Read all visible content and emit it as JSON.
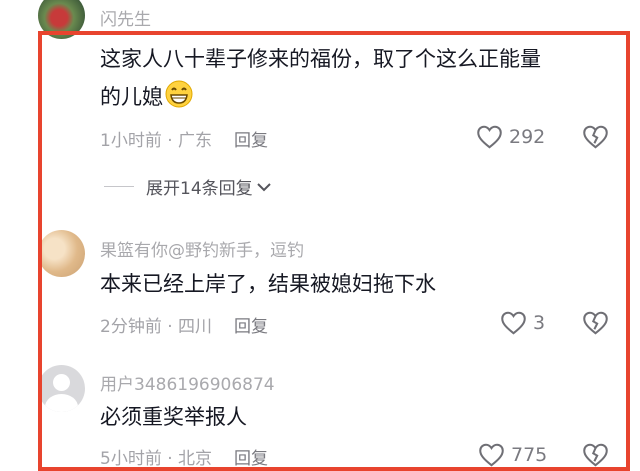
{
  "comments": [
    {
      "username": "闪先生",
      "text_line1": "这家人八十辈子修来的福份，取了个这么正能量",
      "text_line2": "的儿媳",
      "time": "1小时前",
      "location": "广东",
      "reply_label": "回复",
      "likes": "292",
      "expand_label": "展开14条回复",
      "emoji": "grinning-face-emoji"
    },
    {
      "username": "果篮有你@野钓新手，逗钓",
      "text_line1": "本来已经上岸了，结果被媳妇拖下水",
      "time": "2分钟前",
      "location": "四川",
      "reply_label": "回复",
      "likes": "3"
    },
    {
      "username": "用户3486196906874",
      "text_line1": "必须重奖举报人",
      "time": "5小时前",
      "location": "北京",
      "reply_label": "回复",
      "likes": "775"
    }
  ],
  "colors": {
    "highlight_border": "#e8442e",
    "text": "#161823",
    "secondary": "#a3a3a8"
  },
  "icons": [
    "heart-icon",
    "broken-heart-icon",
    "chevron-down-icon",
    "default-avatar-icon"
  ]
}
